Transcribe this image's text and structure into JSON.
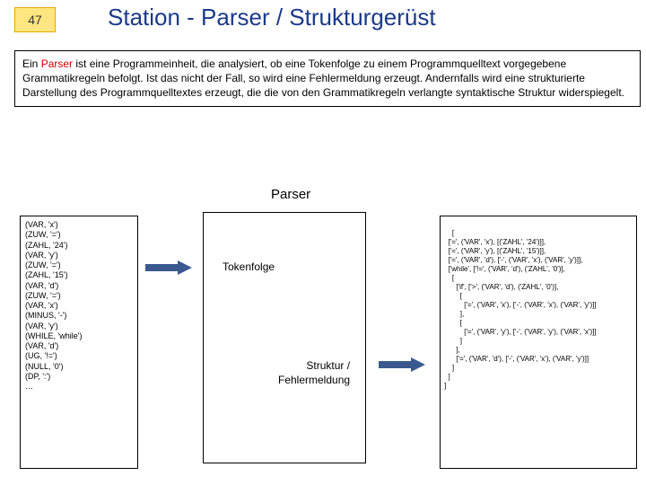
{
  "page_number": "47",
  "title": "Station - Parser / Strukturgerüst",
  "description_html": "Ein {KW}Parser{/KW} ist eine Programmeinheit, die analysiert, ob eine Tokenfolge zu einem Programmquelltext vorgegebene Grammatikregeln befolgt. Ist das nicht der Fall, so wird eine Fehlermeldung erzeugt. Andernfalls wird eine strukturierte Darstellung des Programmquelltextes erzeugt, die die von den Grammatikregeln verlangte syntaktische Struktur widerspiegelt.",
  "parser_label": "Parser",
  "tokenfolge_label": "Tokenfolge",
  "struktur_label": "Struktur /\nFehlermeldung",
  "tokens": [
    "(VAR, 'x')",
    "(ZUW, '=')",
    "(ZAHL, '24')",
    "(VAR, 'y')",
    "(ZUW, '=')",
    "(ZAHL, '15')",
    "(VAR, 'd')",
    "(ZUW, '=')",
    "(VAR, 'x')",
    "(MINUS, '-')",
    "(VAR, 'y')",
    "(WHILE, 'while')",
    "(VAR, 'd')",
    "(UG, '!=')",
    "(NULL, '0')",
    "(DP, ':')",
    "…"
  ],
  "output": "[\n  ['=', ('VAR', 'x'), [('ZAHL', '24')]],\n  ['=', ('VAR', 'y'), [('ZAHL', '15')]],\n  ['=', ('VAR', 'd'), ['-', ('VAR', 'x'), ('VAR', 'y')]],\n  ['while', ['!=', ('VAR', 'd'), ('ZAHL', '0')],\n    [\n      ['if', ['>', ('VAR', 'd'), ('ZAHL', '0')],\n        [\n          ['=', ('VAR', 'x'), ['-', ('VAR', 'x'), ('VAR', 'y')]]\n        ],\n        [\n          ['=', ('VAR', 'y'), ['-', ('VAR', 'y'), ('VAR', 'x')]]\n        ]\n      ],\n      ['=', ('VAR', 'd'), ['-', ('VAR', 'x'), ('VAR', 'y')]]\n    ]\n  ]\n]"
}
